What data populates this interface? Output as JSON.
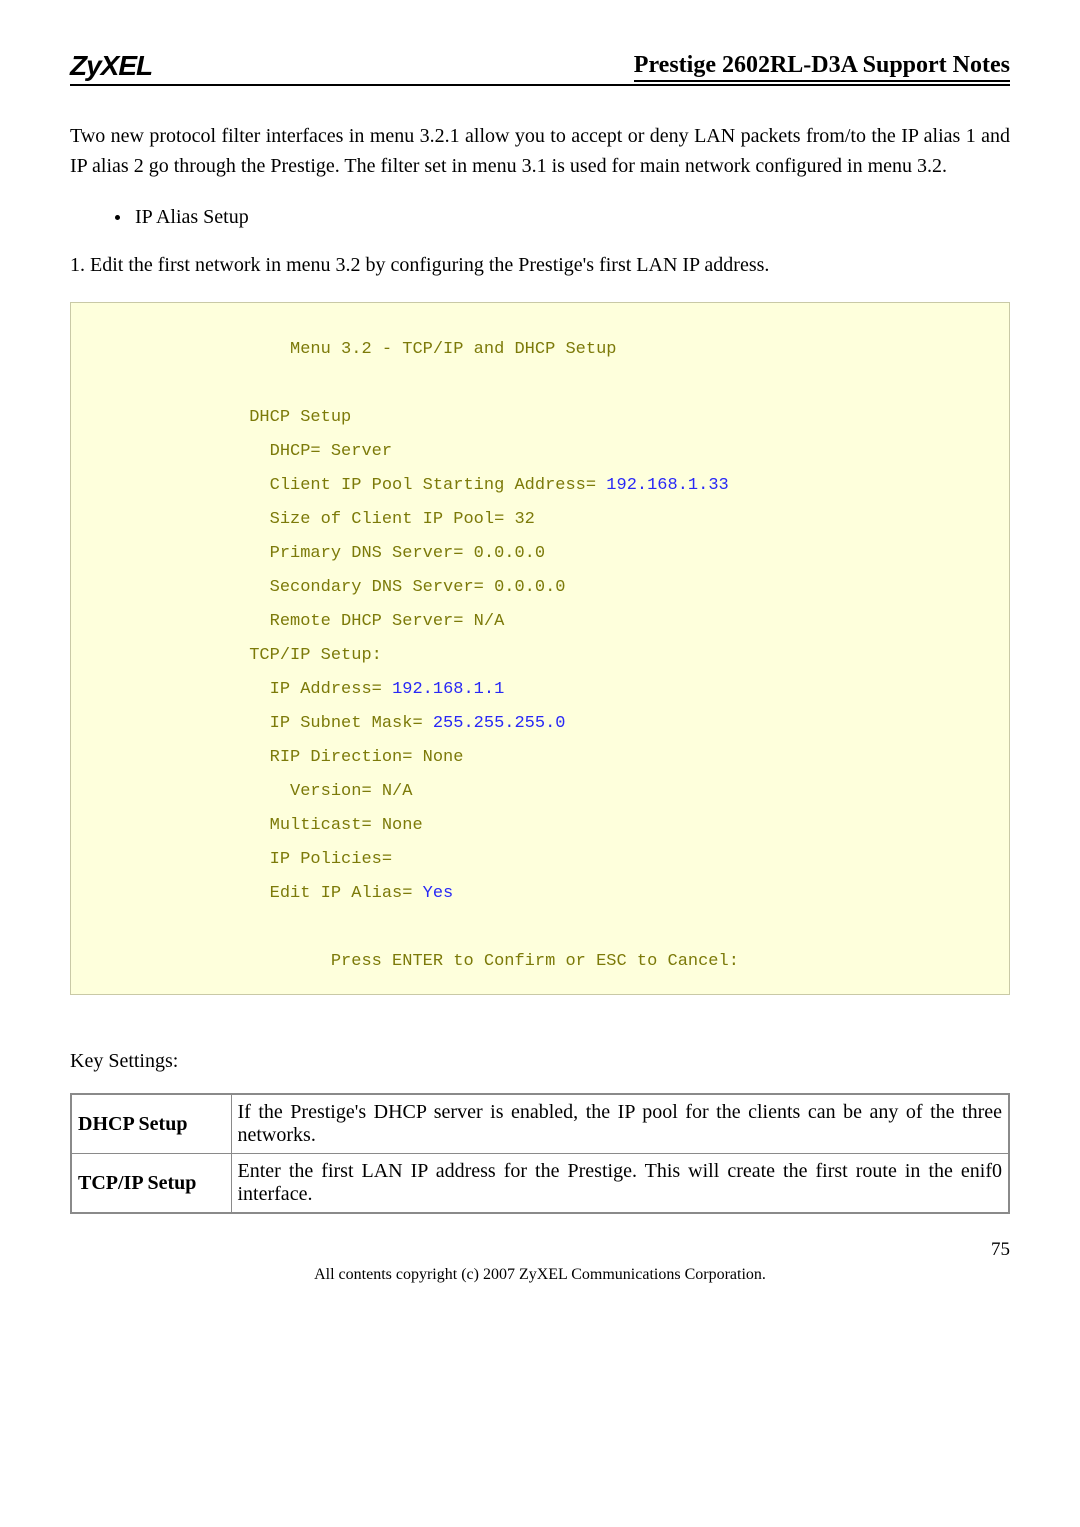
{
  "header": {
    "logo": "ZyXEL",
    "title": "Prestige 2602RL-D3A Support Notes"
  },
  "intro_paragraph": "Two new protocol filter interfaces in menu 3.2.1 allow you to accept or deny LAN packets from/to the IP alias 1 and IP alias 2 go through the Prestige. The filter set in menu 3.1 is used for main network configured in menu 3.2.",
  "bullet": "IP Alias Setup",
  "step1": "1. Edit the first network in menu 3.2 by configuring the Prestige's first LAN IP address.",
  "terminal": {
    "title": "                    Menu 3.2 - TCP/IP and DHCP Setup",
    "l1": "                DHCP Setup",
    "l2": "                  DHCP= Server",
    "l3a": "                  Client IP Pool Starting Address= ",
    "l3b": "192.168.1.33",
    "l4": "                  Size of Client IP Pool= 32",
    "l5": "                  Primary DNS Server= 0.0.0.0",
    "l6": "                  Secondary DNS Server= 0.0.0.0",
    "l7": "                  Remote DHCP Server= N/A",
    "l8": "                TCP/IP Setup:",
    "l9a": "                  IP Address= ",
    "l9b": "192.168.1.1",
    "l10a": "                  IP Subnet Mask= ",
    "l10b": "255.255.255.0",
    "l11": "                  RIP Direction= None",
    "l12": "                    Version= N/A",
    "l13": "                  Multicast= None",
    "l14": "                  IP Policies=",
    "l15a": "                  Edit IP Alias= ",
    "l15b": "Yes",
    "footer": "                        Press ENTER to Confirm or ESC to Cancel:"
  },
  "key_settings_label": "Key Settings:",
  "table": {
    "row1_label": "DHCP Setup",
    "row1_desc": "If the Prestige's DHCP server is enabled, the IP pool for the clients can be any of the three networks.",
    "row2_label": "TCP/IP Setup",
    "row2_desc": "Enter the first LAN IP address for the Prestige. This will create the first route in the enif0 interface."
  },
  "page_number": "75",
  "footer": "All contents copyright (c) 2007 ZyXEL Communications Corporation."
}
